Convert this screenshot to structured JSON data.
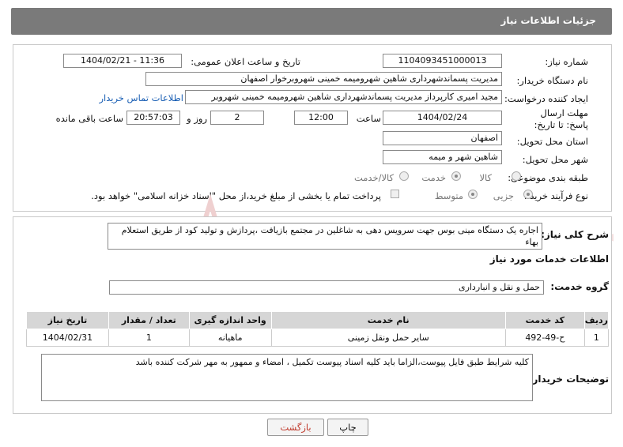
{
  "header": {
    "title": "جزئیات اطلاعات نیاز"
  },
  "form": {
    "need_number_label": "شماره نیاز:",
    "need_number": "1104093451000013",
    "announce_label": "تاریخ و ساعت اعلان عمومی:",
    "announce_value": "1404/02/21 - 11:36",
    "buyer_org_label": "نام دستگاه خریدار:",
    "buyer_org": "مدیریت پسماندشهرداری شاهین شهرومیمه خمینی شهروبرخوار اصفهان",
    "creator_label": "ایجاد کننده درخواست:",
    "creator": "مجید امیری کارپرداز مدیریت پسماندشهرداری شاهین شهرومیمه خمینی شهروبر",
    "contact_link": "اطلاعات تماس خریدار",
    "deadline_label": "مهلت ارسال پاسخ: تا تاریخ:",
    "deadline_date": "1404/02/24",
    "time_label": "ساعت",
    "deadline_time": "12:00",
    "days_value": "2",
    "days_label": "روز و",
    "remaining_time": "20:57:03",
    "remaining_label": "ساعت باقی مانده",
    "province_label": "استان محل تحویل:",
    "province": "اصفهان",
    "city_label": "شهر محل تحویل:",
    "city": "شاهین شهر و میمه",
    "category_label": "طبقه بندی موضوعی:",
    "category_options": [
      "کالا",
      "خدمت",
      "کالا/خدمت"
    ],
    "category_selected": "خدمت",
    "process_label": "نوع فرآیند خرید :",
    "process_options": [
      "جزیی",
      "متوسط"
    ],
    "process_selected": "جزیی",
    "payment_note": "پرداخت تمام یا بخشی از مبلغ خرید،از محل \"اسناد خزانه اسلامی\" خواهد بود."
  },
  "description": {
    "label": "شرح کلی نیاز:",
    "text": "اجاره یک دستگاه مینی بوس جهت سرویس دهی به شاغلین در مجتمع  بازیافت ،پردازش و تولید کود  از طریق استعلام بهاء"
  },
  "services": {
    "section_title": "اطلاعات خدمات مورد نیاز",
    "group_label": "گروه خدمت:",
    "group_value": "حمل و نقل و انبارداری",
    "columns": [
      "ردیف",
      "کد خدمت",
      "نام خدمت",
      "واحد اندازه گیری",
      "تعداد / مقدار",
      "تاریخ نیاز"
    ],
    "rows": [
      [
        "1",
        "ح-49-492",
        "سایر حمل ونقل زمینی",
        "ماهیانه",
        "1",
        "1404/02/31"
      ]
    ]
  },
  "buyer_notes": {
    "label": "توضیحات خریدار:",
    "text": "کلیه شرایط طبق فایل پیوست،الزاما باید کلیه اسناد پیوست تکمیل ، امضاء و ممهور به مهر شرکت کننده باشد"
  },
  "buttons": {
    "print": "چاپ",
    "back": "بازگشت"
  },
  "watermark": {
    "text": "AriaTender.neT"
  },
  "colors": {
    "titlebar": "#7a7a7a",
    "link": "#1a5fb4",
    "back_button_text": "#c0392b",
    "watermark": "#e8c4c4"
  }
}
